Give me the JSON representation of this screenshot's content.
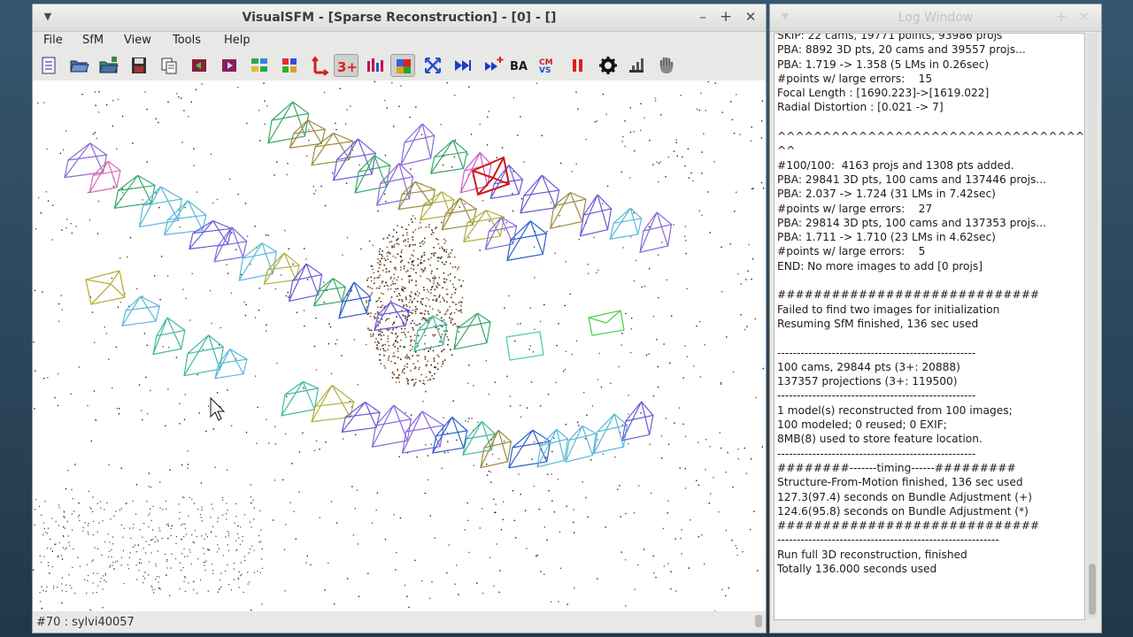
{
  "main_window": {
    "title": "VisualSFM - [Sparse Reconstruction] - [0] - []",
    "menu": [
      "File",
      "SfM",
      "View",
      "Tools",
      "Help"
    ],
    "toolbar": [
      {
        "icon": "notebook-icon"
      },
      {
        "icon": "open-folder-icon"
      },
      {
        "icon": "open-multi-folder-icon"
      },
      {
        "icon": "save-icon"
      },
      {
        "icon": "copy-icon"
      },
      {
        "icon": "prev-icon"
      },
      {
        "icon": "next-icon"
      },
      {
        "icon": "match-icon"
      },
      {
        "icon": "grid-icon"
      },
      {
        "icon": "axis-icon"
      },
      {
        "icon": "three-plus-icon",
        "label": "3+",
        "pressed": true
      },
      {
        "icon": "bars-icon"
      },
      {
        "icon": "cube-icon",
        "pressed": true
      },
      {
        "icon": "cross-arrows-icon"
      },
      {
        "icon": "fast-forward-icon"
      },
      {
        "icon": "fast-forward-plus-icon"
      },
      {
        "icon": "ba-icon",
        "label": "BA"
      },
      {
        "icon": "cmvs-icon"
      },
      {
        "icon": "pause-icon"
      },
      {
        "icon": "gear-icon"
      },
      {
        "icon": "chart-icon"
      },
      {
        "icon": "hand-icon"
      }
    ],
    "status": "#70 : sylvi40057"
  },
  "log_window": {
    "title": "Log Window",
    "lines": [
      "SKIP: 22 cams, 19771 points, 93986 projs",
      "PBA: 8892 3D pts, 20 cams and 39557 projs...",
      "PBA: 1.719 -> 1.358 (5 LMs in 0.26sec)",
      "#points w/ large errors:    15",
      "Focal Length : [1690.223]->[1619.022]",
      "Radial Distortion : [0.021 -> 7]",
      "",
      "^^^^^^^^^^^^^^^^^^^^^^^^^^^^^^^^^^^",
      "^^",
      "#100/100:  4163 projs and 1308 pts added.",
      "PBA: 29841 3D pts, 100 cams and 137446 projs...",
      "PBA: 2.037 -> 1.724 (31 LMs in 7.42sec)",
      "#points w/ large errors:    27",
      "PBA: 29814 3D pts, 100 cams and 137353 projs...",
      "PBA: 1.711 -> 1.710 (23 LMs in 4.62sec)",
      "#points w/ large errors:    5",
      "END: No more images to add [0 projs]",
      "",
      "#############################",
      "Failed to find two images for initialization",
      "Resuming SfM finished, 136 sec used",
      "",
      "---------------------------------------------------",
      "100 cams, 29844 pts (3+: 20888)",
      "137357 projections (3+: 119500)",
      "---------------------------------------------------",
      "1 model(s) reconstructed from 100 images;",
      "100 modeled; 0 reused; 0 EXIF;",
      "8MB(8) used to store feature location.",
      "---------------------------------------------------",
      "########-------timing------#########",
      "Structure-From-Motion finished, 136 sec used",
      "127.3(97.4) seconds on Bundle Adjustment (+)",
      "124.6(95.8) seconds on Bundle Adjustment (*)",
      "#############################",
      "---------------------------------------------------------",
      "Run full 3D reconstruction, finished",
      "Totally 136.000 seconds used"
    ]
  }
}
